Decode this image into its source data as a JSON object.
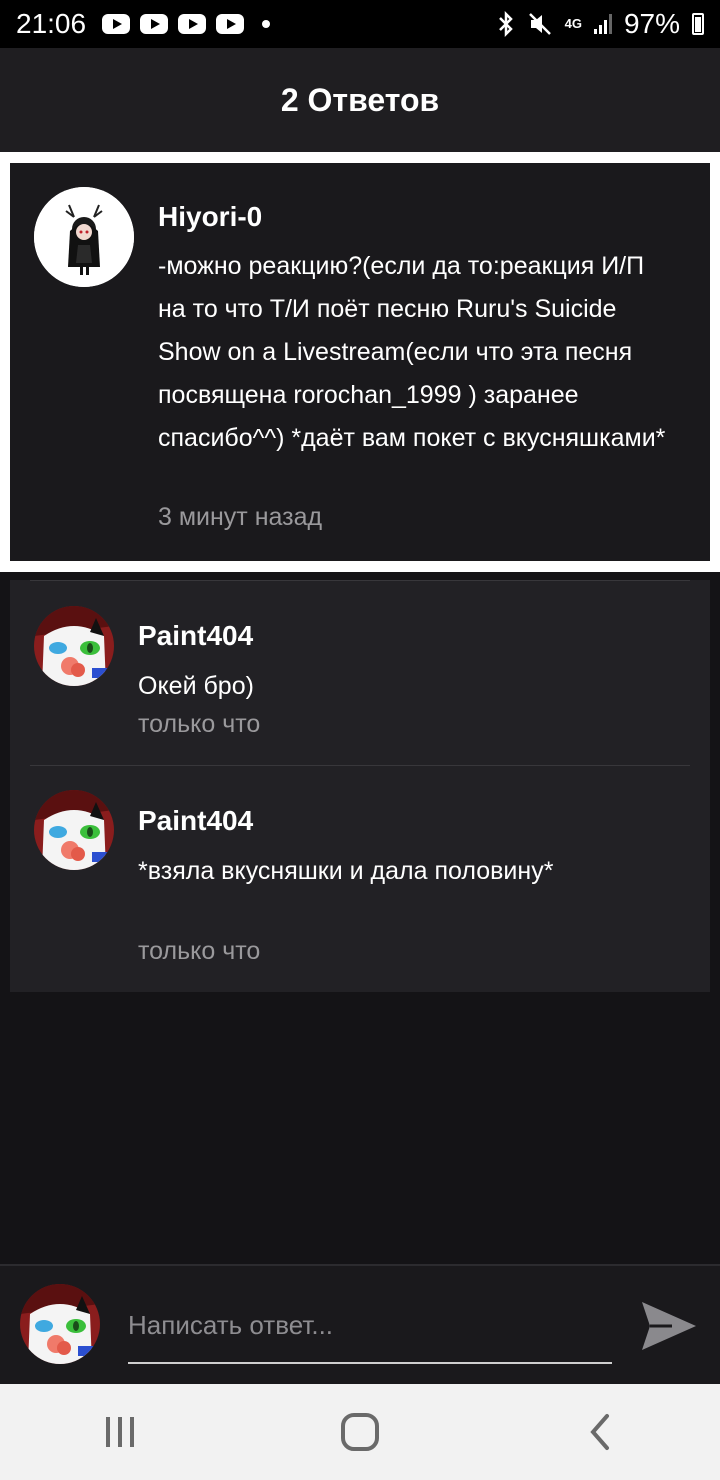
{
  "status_bar": {
    "time": "21:06",
    "network": "4G",
    "battery": "97%",
    "icons": [
      "youtube-icon",
      "youtube-icon",
      "youtube-icon",
      "youtube-icon",
      "bluetooth-icon",
      "mute-icon",
      "signal-icon",
      "battery-icon"
    ]
  },
  "header": {
    "title": "2 Ответов"
  },
  "post": {
    "author": "Hiyori-0",
    "text": "-можно реакцию?(если да то:реакция И/П на то что Т/И поёт песню Ruru's Suicide Show on a Livestream(если что эта песня посвящена rorochan_1999 ) заранее спасибо^^) *даёт вам покет с вкусняшками*",
    "time": "3 минут назад"
  },
  "replies": [
    {
      "author": "Paint404",
      "text": "Окей бро)",
      "time": "только что"
    },
    {
      "author": "Paint404",
      "text": "*взяла вкусняшки и дала половину*",
      "time": "только что"
    }
  ],
  "composer": {
    "placeholder": "Написать ответ..."
  },
  "colors": {
    "background": "#141316",
    "card": "#222125",
    "muted_text": "#9a999c",
    "accent_white": "#ffffff"
  }
}
